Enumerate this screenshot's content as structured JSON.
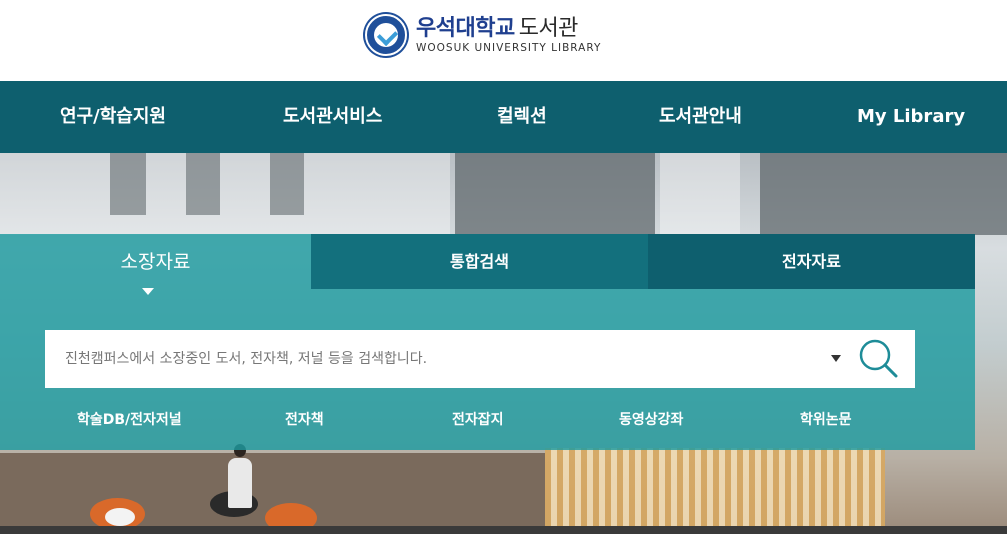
{
  "header": {
    "logo_korean": "우석대학교",
    "logo_korean_sub": "도서관",
    "logo_english": "WOOSUK UNIVERSITY LIBRARY"
  },
  "nav": {
    "items": [
      "연구/학습지원",
      "도서관서비스",
      "컬렉션",
      "도서관안내",
      "My Library"
    ]
  },
  "search": {
    "tabs": [
      "소장자료",
      "통합검색",
      "전자자료"
    ],
    "active_tab": "소장자료",
    "placeholder": "진천캠퍼스에서 소장중인 도서, 전자책, 저널 등을 검색합니다.",
    "quick_links": [
      "학술DB/전자저널",
      "전자책",
      "전자잡지",
      "동영상강좌",
      "학위논문"
    ]
  },
  "colors": {
    "nav_bg": "#0e5f6e",
    "panel_bg": "#1e9ba0",
    "tab_mid": "#13707d",
    "tab_dark": "#0e5f6e",
    "logo_blue": "#1f3f8f"
  },
  "icons": {
    "search": "magnifier-icon",
    "dropdown": "caret-down-icon"
  }
}
